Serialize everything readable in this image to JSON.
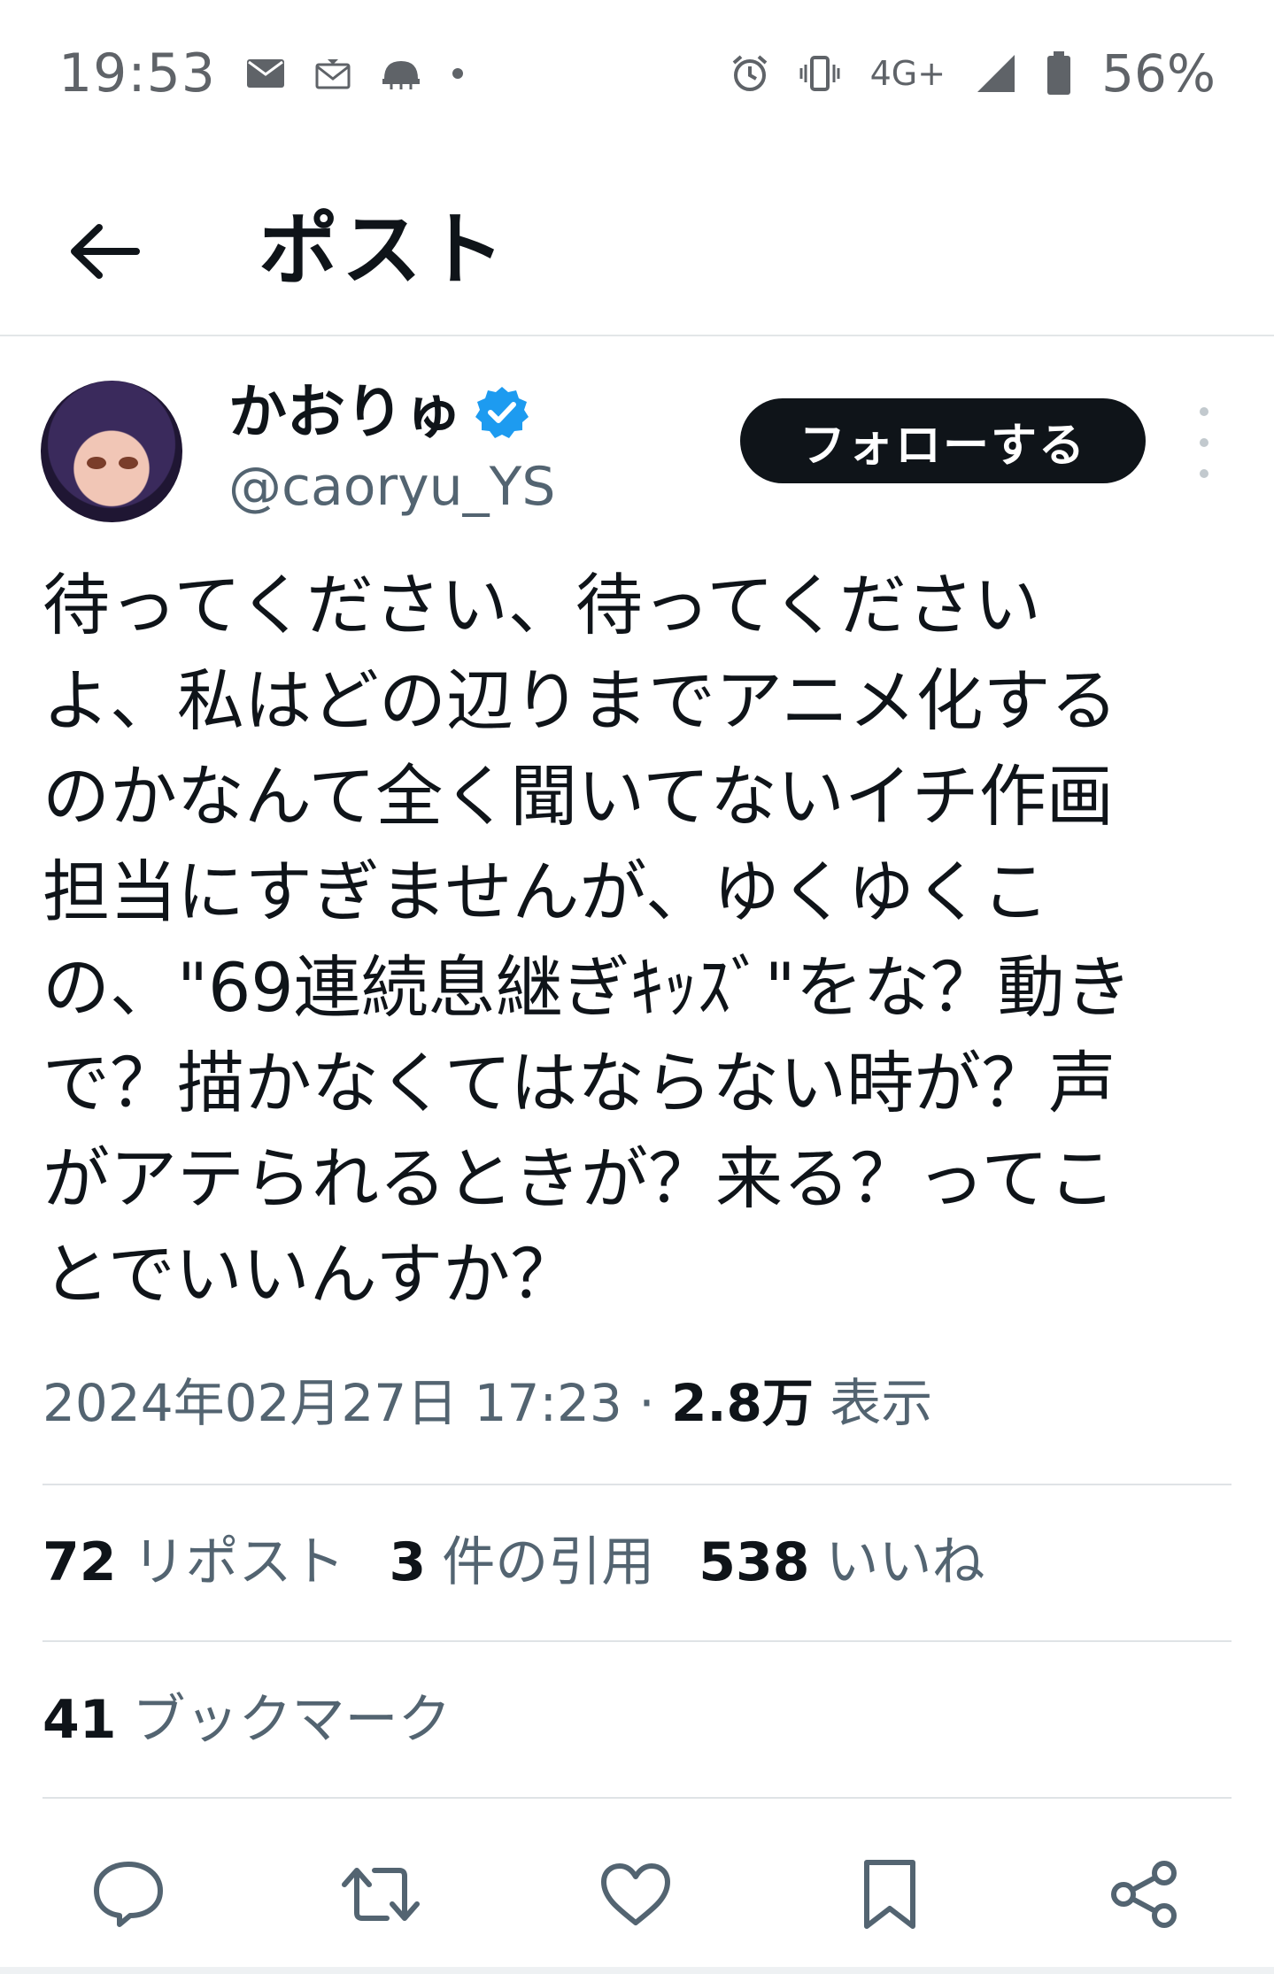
{
  "status_bar": {
    "time": "19:53",
    "network": "4G+",
    "battery": "56%",
    "icons": [
      "mail-icon",
      "mail-outline-icon",
      "helmet-icon",
      "dot-icon",
      "alarm-icon",
      "vibrate-icon",
      "signal-icon",
      "battery-icon"
    ]
  },
  "header": {
    "title": "ポスト",
    "back_icon": "arrow-left-icon"
  },
  "author": {
    "display_name": "かおりゅ",
    "handle": "@caoryu_YS",
    "verified": true,
    "follow_label": "フォローする",
    "more_icon": "vertical-dots-icon"
  },
  "post": {
    "text": "待ってください、待ってください\nよ、私はどの辺りまでアニメ化する\nのかなんて全く聞いてないイチ作画\n担当にすぎませんが、ゆくゆくこ\nの、\"69連続息継ぎｷｯｽﾞ\"をな？動き\nで？描かなくてはならない時が？声\nがアテられるときが？来る？ってこ\nとでいいんすか？",
    "timestamp": "2024年02月27日 17:23",
    "separator": "·",
    "views": "2.8万",
    "views_label": "表示"
  },
  "stats": {
    "reposts_count": "72",
    "reposts_label": "リポスト",
    "quotes_count": "3",
    "quotes_label": "件の引用",
    "likes_count": "538",
    "likes_label": "いいね",
    "bookmarks_count": "41",
    "bookmarks_label": "ブックマーク"
  },
  "actions": [
    "reply-icon",
    "repost-icon",
    "like-icon",
    "bookmark-icon",
    "share-icon"
  ],
  "colors": {
    "text_primary": "#0f1419",
    "text_secondary": "#536471",
    "verified_blue": "#1d9bf0",
    "follow_button_bg": "#0f1419"
  }
}
